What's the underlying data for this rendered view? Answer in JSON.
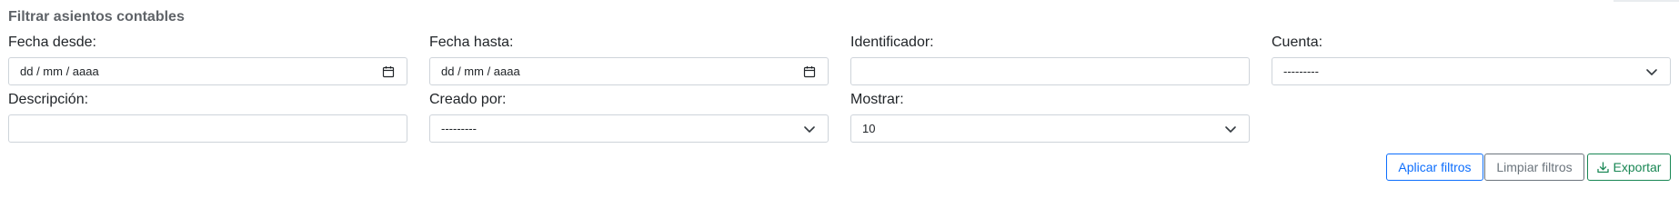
{
  "panel": {
    "title": "Filtrar asientos contables"
  },
  "filters": {
    "fecha_desde": {
      "label": "Fecha desde:",
      "value": "dd / mm / aaaa",
      "icon": "calendar-icon"
    },
    "fecha_hasta": {
      "label": "Fecha hasta:",
      "value": "dd / mm / aaaa",
      "icon": "calendar-icon"
    },
    "identificador": {
      "label": "Identificador:",
      "value": ""
    },
    "cuenta": {
      "label": "Cuenta:",
      "value": "---------",
      "icon": "chevron-down-icon"
    },
    "descripcion": {
      "label": "Descripción:",
      "value": ""
    },
    "creado_por": {
      "label": "Creado por:",
      "value": "---------",
      "icon": "chevron-down-icon"
    },
    "mostrar": {
      "label": "Mostrar:",
      "value": "10",
      "icon": "chevron-down-icon"
    }
  },
  "actions": {
    "apply_label": "Aplicar filtros",
    "clear_label": "Limpiar filtros",
    "export_label": "Exportar",
    "export_icon": "download-icon"
  },
  "colors": {
    "primary": "#0d6efd",
    "secondary": "#6c757d",
    "success": "#198754",
    "border": "#ced4da",
    "title": "#5f6368"
  }
}
